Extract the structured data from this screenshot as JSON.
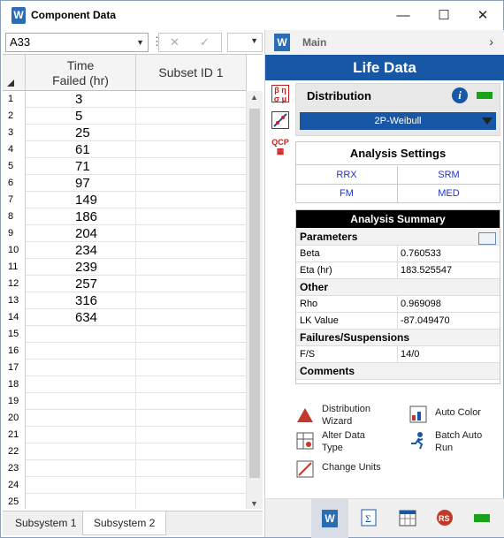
{
  "window": {
    "title": "Component Data",
    "app_icon": "W"
  },
  "formula_bar": {
    "cell_ref": "A33"
  },
  "grid": {
    "columns": [
      "Time\nFailed (hr)",
      "Subset ID 1"
    ],
    "rows": [
      {
        "n": "1",
        "v": "3"
      },
      {
        "n": "2",
        "v": "5"
      },
      {
        "n": "3",
        "v": "25"
      },
      {
        "n": "4",
        "v": "61"
      },
      {
        "n": "5",
        "v": "71"
      },
      {
        "n": "6",
        "v": "97"
      },
      {
        "n": "7",
        "v": "149"
      },
      {
        "n": "8",
        "v": "186"
      },
      {
        "n": "9",
        "v": "204"
      },
      {
        "n": "10",
        "v": "234"
      },
      {
        "n": "11",
        "v": "239"
      },
      {
        "n": "12",
        "v": "257"
      },
      {
        "n": "13",
        "v": "316"
      },
      {
        "n": "14",
        "v": "634"
      },
      {
        "n": "15",
        "v": ""
      },
      {
        "n": "16",
        "v": ""
      },
      {
        "n": "17",
        "v": ""
      },
      {
        "n": "18",
        "v": ""
      },
      {
        "n": "19",
        "v": ""
      },
      {
        "n": "20",
        "v": ""
      },
      {
        "n": "21",
        "v": ""
      },
      {
        "n": "22",
        "v": ""
      },
      {
        "n": "23",
        "v": ""
      },
      {
        "n": "24",
        "v": ""
      },
      {
        "n": "25",
        "v": ""
      }
    ]
  },
  "sheet_tabs": [
    "Subsystem 1",
    "Subsystem 2"
  ],
  "panel": {
    "main_label": "Main",
    "header": "Life Data",
    "distribution_label": "Distribution",
    "distribution_value": "2P-Weibull",
    "analysis_settings": "Analysis Settings",
    "settings_buttons": [
      "RRX",
      "SRM",
      "FM",
      "MED"
    ],
    "summary_title": "Analysis Summary",
    "summary": [
      {
        "type": "sec",
        "k": "Parameters"
      },
      {
        "type": "row",
        "k": "Beta",
        "v": "0.760533"
      },
      {
        "type": "row",
        "k": "Eta (hr)",
        "v": "183.525547"
      },
      {
        "type": "sec",
        "k": "Other"
      },
      {
        "type": "row",
        "k": "Rho",
        "v": "0.969098"
      },
      {
        "type": "row",
        "k": "LK Value",
        "v": "-87.049470"
      },
      {
        "type": "sec",
        "k": "Failures/Suspensions"
      },
      {
        "type": "row",
        "k": "F/S",
        "v": "14/0"
      },
      {
        "type": "sec",
        "k": "Comments"
      }
    ],
    "tools": {
      "distribution_wizard": "Distribution\nWizard",
      "auto_color": "Auto Color",
      "alter_data_type": "Alter Data\nType",
      "batch_auto_run": "Batch Auto\nRun",
      "change_units": "Change Units"
    },
    "side_icon_labels": {
      "params": "β η\nσ μ",
      "qcp": "QCP"
    },
    "colors": {
      "accent": "#1857a6",
      "status_green": "#1aa31a"
    }
  }
}
